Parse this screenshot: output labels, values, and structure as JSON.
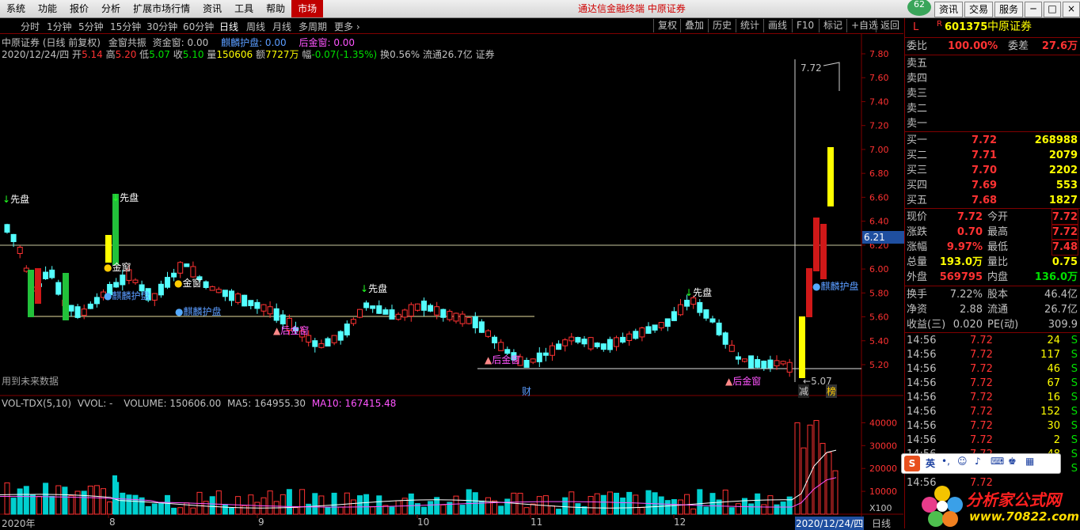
{
  "menu": [
    "系统",
    "功能",
    "报价",
    "分析",
    "扩展市场行情",
    "资讯",
    "工具",
    "帮助",
    "市场"
  ],
  "app_title": "通达信金融终端  中原证券",
  "badge": "62",
  "top_buttons": [
    "资讯",
    "交易",
    "服务"
  ],
  "window_buttons": [
    "─",
    "□",
    "×"
  ],
  "periods": [
    "分时",
    "1分钟",
    "5分钟",
    "15分钟",
    "30分钟",
    "60分钟",
    "日线",
    "周线",
    "月线",
    "多周期",
    "更多 ›"
  ],
  "tools": [
    "复权",
    "叠加",
    "历史",
    "统计",
    "画线",
    "F10",
    "标记",
    "+自选",
    "返回"
  ],
  "chart": {
    "title_line": "中原证券 (日线 前复权)",
    "indicator_name": "金窗共振",
    "zijinchuang": "资金窗: 0.00",
    "qilin": "麒麟护盘: 0.00",
    "houjinchuang": "后金窗: 0.00",
    "date": "2020/12/24/四",
    "open_label": "开",
    "open": "5.14",
    "high_label": "高",
    "high": "5.20",
    "low_label": "低",
    "low": "5.07",
    "close_label": "收",
    "close": "5.10",
    "vol_label": "量",
    "vol": "150606",
    "amt_label": "额",
    "amt": "7727万",
    "chg_label": "幅",
    "chg": "-0.07(-1.35%)",
    "turn": "换0.56%",
    "float": "流通26.7亿",
    "sector": "证券",
    "future_note": "用到未来数据",
    "price_axis": [
      "7.80",
      "7.60",
      "7.40",
      "7.20",
      "7.00",
      "6.80",
      "6.60",
      "6.40",
      "6.20",
      "6.00",
      "5.80",
      "5.60",
      "5.40",
      "5.20"
    ],
    "current_price_tag": "6.21",
    "high_mark": "7.72",
    "low_mark": "5.07",
    "markers": {
      "xianpan": "先盘",
      "jinchuang": "金窗",
      "qilin": "麒麟护盘",
      "houjinchuang": "后金窗",
      "cai": "财",
      "jian": "减",
      "bang": "榜"
    }
  },
  "volume": {
    "name": "VOL-TDX(5,10)",
    "vvol": "VVOL: -",
    "volume": "VOLUME: 150606.00",
    "ma5": "MA5: 164955.30",
    "ma10": "MA10: 167415.48",
    "axis": [
      "40000",
      "30000",
      "20000",
      "10000",
      "X100"
    ]
  },
  "date_axis": [
    "2020年",
    "8",
    "9",
    "10",
    "11",
    "12"
  ],
  "date_highlight": "2020/12/24/四",
  "date_mode": "日线",
  "quote": {
    "market": "L",
    "r_flag": "R",
    "code": "601375",
    "name": "中原证券",
    "weibi_label": "委比",
    "weibi": "100.00%",
    "weicha_label": "委差",
    "weicha": "27.6万",
    "asks": [
      {
        "label": "卖五",
        "price": "",
        "vol": ""
      },
      {
        "label": "卖四",
        "price": "",
        "vol": ""
      },
      {
        "label": "卖三",
        "price": "",
        "vol": ""
      },
      {
        "label": "卖二",
        "price": "",
        "vol": ""
      },
      {
        "label": "卖一",
        "price": "",
        "vol": ""
      }
    ],
    "bids": [
      {
        "label": "买一",
        "price": "7.72",
        "vol": "268988"
      },
      {
        "label": "买二",
        "price": "7.71",
        "vol": "2079"
      },
      {
        "label": "买三",
        "price": "7.70",
        "vol": "2202"
      },
      {
        "label": "买四",
        "price": "7.69",
        "vol": "553"
      },
      {
        "label": "买五",
        "price": "7.68",
        "vol": "1827"
      }
    ],
    "stats": [
      {
        "l1": "现价",
        "v1": "7.72",
        "l2": "今开",
        "v2": "7.72"
      },
      {
        "l1": "涨跌",
        "v1": "0.70",
        "l2": "最高",
        "v2": "7.72"
      },
      {
        "l1": "涨幅",
        "v1": "9.97%",
        "l2": "最低",
        "v2": "7.48"
      },
      {
        "l1": "总量",
        "v1": "193.0万",
        "l2": "量比",
        "v2": "0.75"
      },
      {
        "l1": "外盘",
        "v1": "569795",
        "l2": "内盘",
        "v2": "136.0万"
      }
    ],
    "stats2": [
      {
        "l1": "换手",
        "v1": "7.22%",
        "l2": "股本",
        "v2": "46.4亿"
      },
      {
        "l1": "净资",
        "v1": "2.88",
        "l2": "流通",
        "v2": "26.7亿"
      },
      {
        "l1": "收益(三)",
        "v1": "0.020",
        "l2": "PE(动)",
        "v2": "309.9"
      }
    ],
    "ticks": [
      {
        "t": "14:56",
        "p": "7.72",
        "v": "24",
        "s": "S"
      },
      {
        "t": "14:56",
        "p": "7.72",
        "v": "117",
        "s": "S"
      },
      {
        "t": "14:56",
        "p": "7.72",
        "v": "46",
        "s": "S"
      },
      {
        "t": "14:56",
        "p": "7.72",
        "v": "67",
        "s": "S"
      },
      {
        "t": "14:56",
        "p": "7.72",
        "v": "16",
        "s": "S"
      },
      {
        "t": "14:56",
        "p": "7.72",
        "v": "152",
        "s": "S"
      },
      {
        "t": "14:56",
        "p": "7.72",
        "v": "30",
        "s": "S"
      },
      {
        "t": "14:56",
        "p": "7.72",
        "v": "2",
        "s": "S"
      },
      {
        "t": "14:56",
        "p": "7.72",
        "v": "48",
        "s": "S"
      },
      {
        "t": "14:56",
        "p": "7.72",
        "v": "24",
        "s": "S"
      },
      {
        "t": "14:56",
        "p": "7.72",
        "v": "",
        "s": ""
      }
    ]
  },
  "ime": {
    "logo": "S",
    "lang": "英"
  },
  "watermark": {
    "line1": "分析家公式网",
    "line2": "www.70822.com"
  },
  "colors": {
    "up": "#ff3232",
    "down": "#54ffff",
    "upfill": "#ff3232",
    "down_bar": "#00cfcf",
    "bg": "#000000",
    "axis": "#800000",
    "yellow": "#ffff00",
    "green": "#22c13a",
    "ma5": "#ffffff",
    "ma10": "#ff55ff"
  }
}
